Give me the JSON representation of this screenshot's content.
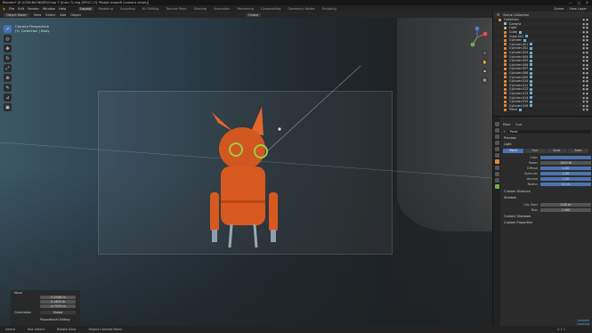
{
  "title_bar": {
    "title": "Blender* [E:\\CGW-BLENDER\\Chap 7 (Intro 7).img [EPLIC-CI] *Robot shapeB (camera views)]",
    "controls": [
      "—",
      "□",
      "✕"
    ]
  },
  "menu": {
    "items": [
      "File",
      "Edit",
      "Render",
      "Window",
      "Help"
    ],
    "workspaces": [
      "Layout",
      "Modeling",
      "Sculpting",
      "UV Editing",
      "Texture Paint",
      "Shading",
      "Animation",
      "Rendering",
      "Compositing",
      "Geometry Nodes",
      "Scripting"
    ],
    "active_workspace": "Layout",
    "scene": "Scene",
    "view_layer": "View Layer"
  },
  "viewport_header": {
    "mode": "Object Mode",
    "items": [
      "View",
      "Select",
      "Add",
      "Object"
    ],
    "orientation": "Global"
  },
  "viewport": {
    "camera_label": "Camera Perspective",
    "collection_label": "(1) Collection | Body"
  },
  "toolbar": {
    "tools": [
      "select-icon",
      "cursor-icon",
      "move-icon",
      "rotate-icon",
      "scale-icon",
      "transform-icon",
      "annotate-icon",
      "measure-icon",
      "add-cube-icon"
    ]
  },
  "operator_panel": {
    "title": "Move",
    "fields": [
      "-0.2546 m",
      "0.1459 m",
      "-0.7515 m"
    ],
    "orientation_label": "Orientation",
    "orientation_value": "Global",
    "proportional": "Proportional Editing"
  },
  "outliner": {
    "header": "Scene Collection",
    "rows": [
      {
        "name": "Collection",
        "type": "collection",
        "selected": false
      },
      {
        "name": "Camera",
        "type": "cam",
        "selected": false
      },
      {
        "name": "Light",
        "type": "light",
        "selected": false
      },
      {
        "name": "Cube",
        "type": "mesh",
        "selected": false
      },
      {
        "name": "Cube.001",
        "type": "mesh",
        "selected": false
      },
      {
        "name": "Cylinder",
        "type": "mesh",
        "selected": false
      },
      {
        "name": "Cylinder.001",
        "type": "mesh",
        "selected": false
      },
      {
        "name": "Cylinder.002",
        "type": "mesh",
        "selected": false
      },
      {
        "name": "Cylinder.003",
        "type": "mesh",
        "selected": false
      },
      {
        "name": "Cylinder.004",
        "type": "mesh",
        "selected": false
      },
      {
        "name": "Cylinder.005",
        "type": "mesh",
        "selected": false
      },
      {
        "name": "Cylinder.006",
        "type": "mesh",
        "selected": false
      },
      {
        "name": "Cylinder.007",
        "type": "mesh",
        "selected": false
      },
      {
        "name": "Cylinder.008",
        "type": "mesh",
        "selected": false
      },
      {
        "name": "Cylinder.009",
        "type": "mesh",
        "selected": false
      },
      {
        "name": "Cylinder.010",
        "type": "mesh",
        "selected": false
      },
      {
        "name": "Cylinder.011",
        "type": "mesh",
        "selected": false
      },
      {
        "name": "Cylinder.012",
        "type": "mesh",
        "selected": false
      },
      {
        "name": "Cylinder.013",
        "type": "mesh",
        "selected": false
      },
      {
        "name": "Cylinder.014",
        "type": "mesh",
        "selected": false
      },
      {
        "name": "Cylinder.015",
        "type": "mesh",
        "selected": false
      },
      {
        "name": "Cylinder.016",
        "type": "mesh",
        "selected": false
      },
      {
        "name": "Plane",
        "type": "mesh",
        "selected": false
      }
    ]
  },
  "properties": {
    "tab_buttons": [
      "Point",
      "Sun",
      "Spot",
      "Area"
    ],
    "active_tab": "Point",
    "object_name": "Point",
    "preview_label": "Preview",
    "light_label": "Light",
    "light_types": [
      "Point",
      "Sun",
      "Spot",
      "Area"
    ],
    "fields": [
      {
        "label": "Color",
        "value": "",
        "style": "blue"
      },
      {
        "label": "Power",
        "value": "1000 W",
        "style": "grey"
      },
      {
        "label": "Diffuse",
        "value": "1.00",
        "style": "blue"
      },
      {
        "label": "Specular",
        "value": "1.00",
        "style": "blue"
      },
      {
        "label": "Volume",
        "value": "1.00",
        "style": "blue"
      },
      {
        "label": "Radius",
        "value": "0.1 m",
        "style": "blue"
      }
    ],
    "sections": [
      "Custom Distance",
      "Shadow",
      "Contact Shadows",
      "Custom Properties"
    ],
    "shadow_fields": [
      {
        "label": "Clip Start",
        "value": "0.05 m"
      },
      {
        "label": "Bias",
        "value": "1.000"
      }
    ]
  },
  "status_bar": {
    "items": [
      "Select",
      "Box Select",
      "Rotate View",
      "Object Context Menu"
    ],
    "version": "3.1.2"
  },
  "logo_text": "LinkedIn Learning"
}
